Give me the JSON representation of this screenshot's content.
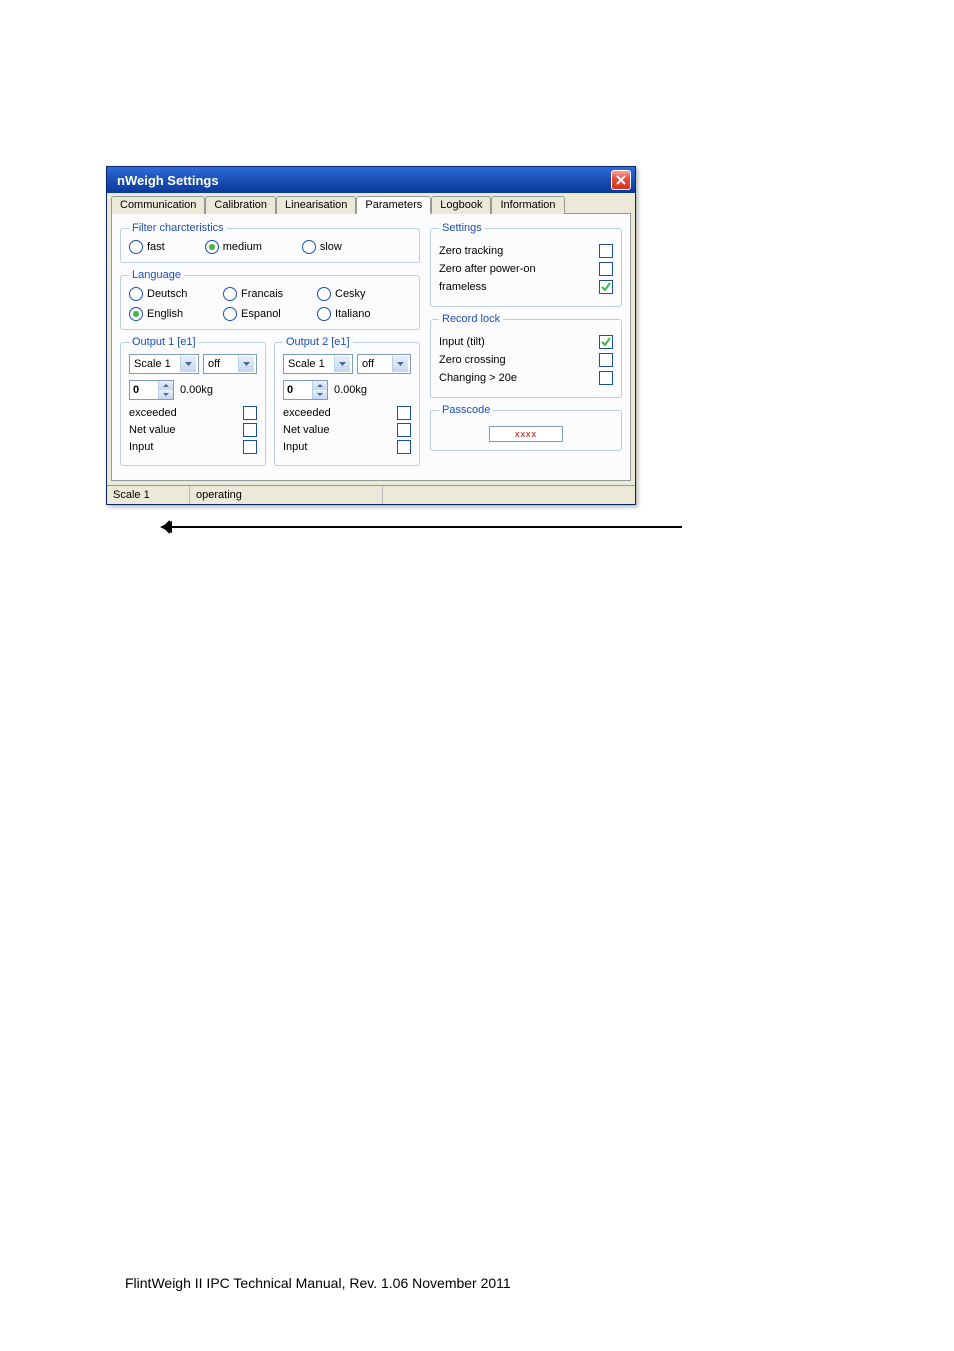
{
  "window": {
    "title": "nWeigh Settings"
  },
  "tabs": {
    "t0": "Communication",
    "t1": "Calibration",
    "t2": "Linearisation",
    "t3": "Parameters",
    "t4": "Logbook",
    "t5": "Information"
  },
  "filter": {
    "legend": "Filter charcteristics",
    "fast": "fast",
    "medium": "medium",
    "slow": "slow"
  },
  "language": {
    "legend": "Language",
    "de": "Deutsch",
    "fr": "Francais",
    "cs": "Cesky",
    "en": "English",
    "es": "Espanol",
    "it": "Italiano"
  },
  "output1": {
    "legend": "Output 1 [e1]",
    "scale": "Scale 1",
    "mode": "off",
    "spin": "0",
    "unit": "0.00kg",
    "exceeded": "exceeded",
    "net": "Net value",
    "input": "Input"
  },
  "output2": {
    "legend": "Output 2 [e1]",
    "scale": "Scale 1",
    "mode": "off",
    "spin": "0",
    "unit": "0.00kg",
    "exceeded": "exceeded",
    "net": "Net value",
    "input": "Input"
  },
  "settings": {
    "legend": "Settings",
    "zero_tracking": "Zero tracking",
    "zero_after": "Zero after power-on",
    "frameless": "frameless"
  },
  "recordlock": {
    "legend": "Record lock",
    "tilt": "Input (tilt)",
    "zcross": "Zero crossing",
    "chg": "Changing > 20e"
  },
  "passcode": {
    "legend": "Passcode",
    "value": "xxxx"
  },
  "status": {
    "scale": "Scale 1",
    "mode": "operating"
  },
  "footer": "FlintWeigh II IPC Technical Manual, Rev. 1.06   November 2011"
}
